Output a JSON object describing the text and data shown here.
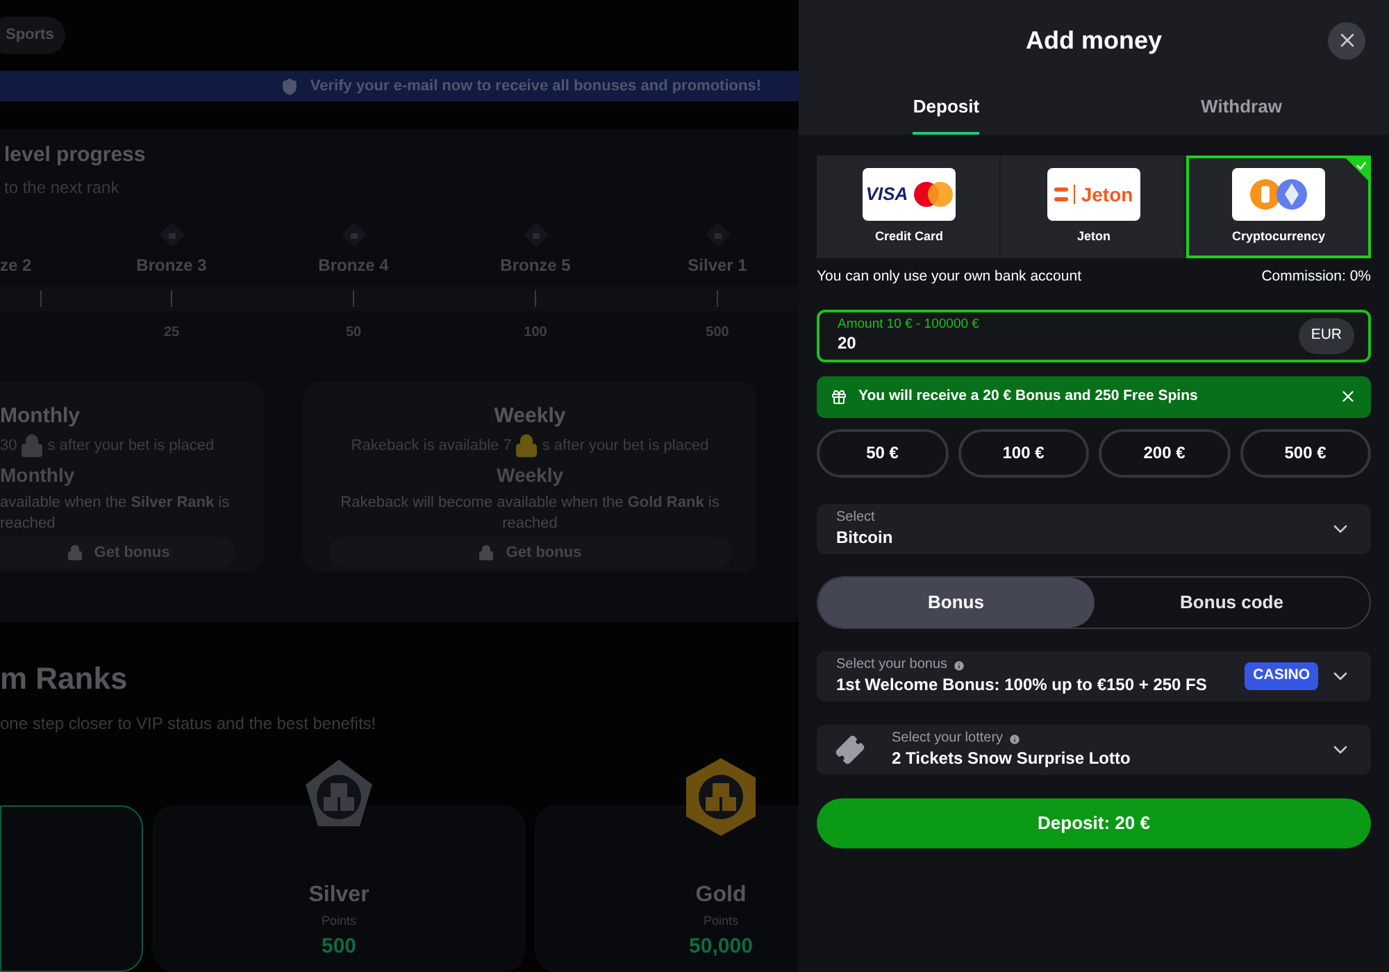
{
  "background": {
    "nav": [
      {
        "label": "Sports"
      }
    ],
    "verify_banner": "Verify your e-mail now to receive all bonuses and promotions!",
    "level_progress": {
      "title": "level progress",
      "subtitle": "to the next rank",
      "ranks": [
        {
          "name": "ze 2"
        },
        {
          "name": "Bronze 3",
          "value": "25"
        },
        {
          "name": "Bronze 4",
          "value": "50"
        },
        {
          "name": "Bronze 5",
          "value": "100"
        },
        {
          "name": "Silver 1",
          "value": "500"
        }
      ]
    },
    "rakeback": [
      {
        "title": "Monthly",
        "text_before": "30",
        "text_after": "s after your bet is placed",
        "color": "#3c3d42",
        "subtitle": "Monthly",
        "note": "available when the **Silver Rank** is reached",
        "button": "Get bonus"
      },
      {
        "title": "Weekly",
        "text_before": "Rakeback is available 7",
        "text_after": "s after your bet is placed",
        "color": "#6a5810",
        "subtitle": "Weekly",
        "note": "Rakeback will become available when the **Gold Rank** is reached",
        "button": "Get bonus"
      }
    ],
    "ranks_title": "m Ranks",
    "ranks_subtitle": "one step closer to VIP status and the best benefits!",
    "rank_cards": [
      {
        "selected": true
      },
      {
        "selected": false,
        "kind": "silver",
        "name": "Silver",
        "points_label": "Points",
        "points": "500"
      },
      {
        "selected": false,
        "kind": "gold",
        "name": "Gold",
        "points_label": "Points",
        "points": "50,000"
      }
    ]
  },
  "dialog": {
    "title": "Add money",
    "tabs": [
      {
        "label": "Deposit",
        "selected": true
      },
      {
        "label": "Withdraw",
        "selected": false
      }
    ],
    "methods": [
      {
        "label": "Credit Card",
        "kind": "cards",
        "logo_text": "VISA",
        "selected": false
      },
      {
        "label": "Jeton",
        "kind": "jeton",
        "logo_text": "Jeton",
        "selected": false
      },
      {
        "label": "Cryptocurrency",
        "kind": "crypto",
        "selected": true
      }
    ],
    "notice": "You can only use your own bank account",
    "commission": "Commission: 0%",
    "amount": {
      "label": "Amount 10 € - 100000 €",
      "value": "20",
      "currency": "EUR"
    },
    "bonus_banner": "You will receive a 20 € Bonus and 250 Free Spins",
    "quick_amounts": [
      "50 €",
      "100 €",
      "200 €",
      "500 €"
    ],
    "currency_select": {
      "label": "Select",
      "value": "Bitcoin"
    },
    "bonus_switch": [
      {
        "label": "Bonus",
        "selected": true
      },
      {
        "label": "Bonus code",
        "selected": false
      }
    ],
    "bonus_select": {
      "label": "Select your bonus",
      "value": "1st Welcome Bonus: 100% up to €150 + 250 FS",
      "badge": "CASINO"
    },
    "lottery_select": {
      "label": "Select your lottery",
      "value": "2 Tickets Snow Surprise Lotto"
    },
    "deposit_button": "Deposit: 20 €"
  }
}
